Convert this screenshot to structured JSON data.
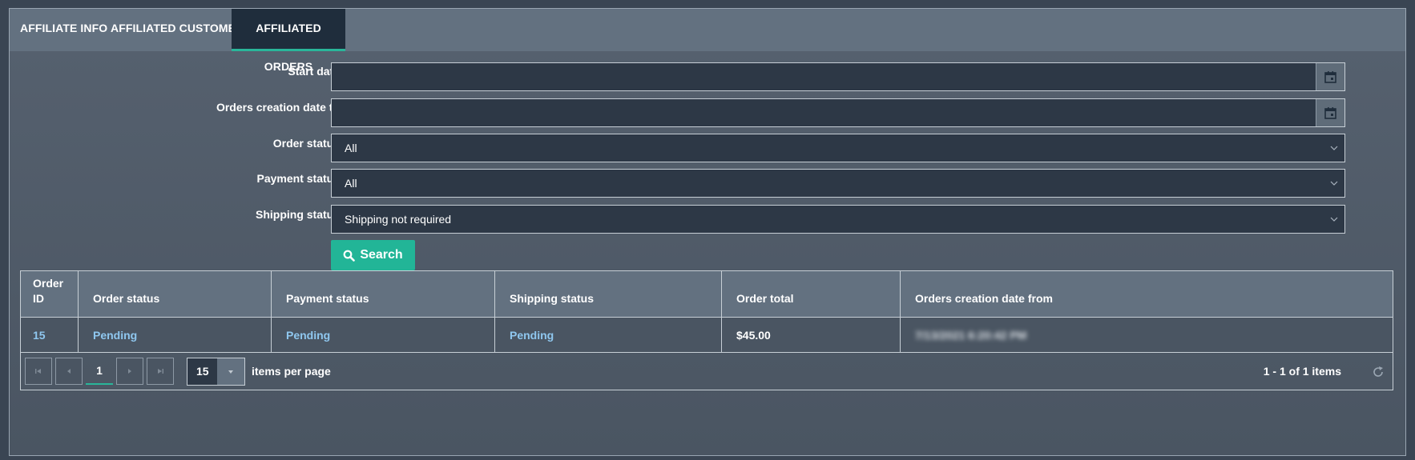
{
  "tabs": [
    {
      "label": "AFFILIATE INFO",
      "active": false
    },
    {
      "label": "AFFILIATED CUSTOMERS",
      "active": false
    },
    {
      "label": "AFFILIATED ORDERS",
      "active": true
    }
  ],
  "filters": {
    "start_date": {
      "label": "Start date",
      "value": ""
    },
    "end_date": {
      "label": "Orders creation date to",
      "value": ""
    },
    "order_status": {
      "label": "Order status",
      "value": "All"
    },
    "payment_status": {
      "label": "Payment status",
      "value": "All"
    },
    "shipping_status": {
      "label": "Shipping status",
      "value": "Shipping not required"
    },
    "search_label": "Search"
  },
  "table": {
    "columns": [
      "Order ID",
      "Order status",
      "Payment status",
      "Shipping status",
      "Order total",
      "Orders creation date from"
    ],
    "rows": [
      {
        "order_id": "15",
        "order_status": "Pending",
        "payment_status": "Pending",
        "shipping_status": "Pending",
        "order_total": "$45.00",
        "created": "7/13/2021 6:20:42 PM"
      }
    ]
  },
  "pager": {
    "current_page": "1",
    "page_size": "15",
    "items_per_page_label": "items per page",
    "info": "1 - 1 of 1 items"
  },
  "colors": {
    "accent": "#2ab69a",
    "button": "#22b597",
    "link": "#8fc7ef",
    "tab_active_bg": "#1f2d3c"
  },
  "icons": [
    "calendar-icon",
    "chevron-down-icon",
    "search-icon",
    "first-page-icon",
    "prev-page-icon",
    "next-page-icon",
    "last-page-icon",
    "refresh-icon"
  ]
}
